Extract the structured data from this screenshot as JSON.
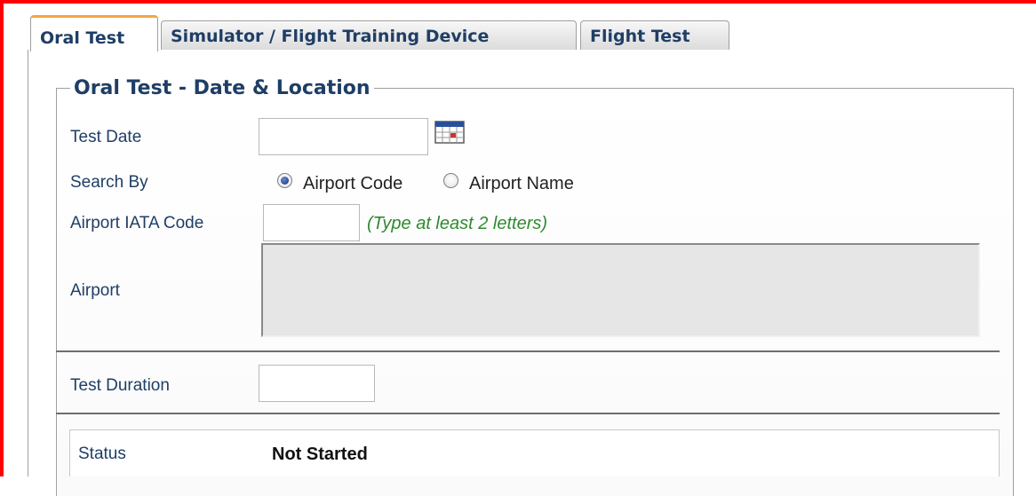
{
  "tabs": [
    {
      "label": "Oral Test",
      "active": true
    },
    {
      "label": "Simulator / Flight Training Device",
      "active": false
    },
    {
      "label": "Flight Test",
      "active": false
    }
  ],
  "section": {
    "legend": "Oral Test - Date & Location"
  },
  "form": {
    "test_date": {
      "label": "Test Date",
      "value": "",
      "icon": "calendar-icon"
    },
    "search_by": {
      "label": "Search By",
      "options": [
        {
          "label": "Airport Code",
          "checked": true
        },
        {
          "label": "Airport Name",
          "checked": false
        }
      ]
    },
    "airport_iata": {
      "label": "Airport IATA Code",
      "value": "",
      "hint": "(Type at least 2 letters)"
    },
    "airport": {
      "label": "Airport",
      "value": ""
    },
    "test_duration": {
      "label": "Test Duration",
      "value": ""
    },
    "status": {
      "label": "Status",
      "value": "Not Started"
    }
  },
  "colors": {
    "accent_tab_top": "#f2a640",
    "label_text": "#1f3e66",
    "hint_text": "#2f8a2f",
    "outer_frame": "#ff0000"
  }
}
